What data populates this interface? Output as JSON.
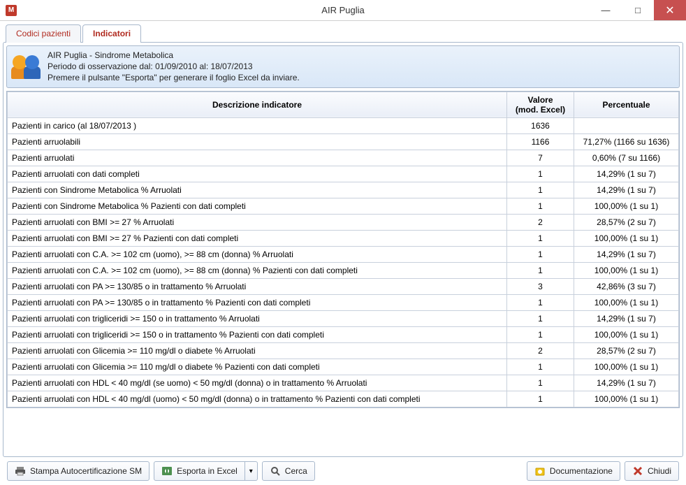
{
  "window": {
    "title": "AIR Puglia",
    "icon_letter": "M"
  },
  "tabs": [
    {
      "label": "Codici pazienti",
      "active": false
    },
    {
      "label": "Indicatori",
      "active": true
    }
  ],
  "infobar": {
    "line1": "AIR Puglia - Sindrome Metabolica",
    "line2": "Periodo di osservazione dal: 01/09/2010 al: 18/07/2013",
    "line3": "Premere il pulsante \"Esporta\" per generare il foglio Excel da inviare."
  },
  "grid": {
    "headers": {
      "desc": "Descrizione indicatore",
      "val_line1": "Valore",
      "val_line2": "(mod. Excel)",
      "pct": "Percentuale"
    },
    "rows": [
      {
        "desc": "Pazienti in carico (al 18/07/2013 )",
        "val": "1636",
        "pct": ""
      },
      {
        "desc": "Pazienti arruolabili",
        "val": "1166",
        "pct": "71,27% (1166 su 1636)"
      },
      {
        "desc": "Pazienti arruolati",
        "val": "7",
        "pct": "0,60% (7 su 1166)"
      },
      {
        "desc": "Pazienti arruolati con dati completi",
        "val": "1",
        "pct": "14,29% (1 su 7)"
      },
      {
        "desc": "Pazienti con Sindrome Metabolica  % Arruolati",
        "val": "1",
        "pct": "14,29% (1 su 7)"
      },
      {
        "desc": "Pazienti con Sindrome Metabolica  % Pazienti con dati completi",
        "val": "1",
        "pct": "100,00% (1 su 1)"
      },
      {
        "desc": "Pazienti arruolati con BMI >= 27  % Arruolati",
        "val": "2",
        "pct": "28,57% (2 su 7)"
      },
      {
        "desc": "Pazienti arruolati con BMI >= 27  % Pazienti con dati completi",
        "val": "1",
        "pct": "100,00% (1 su 1)"
      },
      {
        "desc": "Pazienti arruolati con C.A. >= 102 cm (uomo), >= 88 cm (donna) % Arruolati",
        "val": "1",
        "pct": "14,29% (1 su 7)"
      },
      {
        "desc": "Pazienti arruolati con C.A. >= 102 cm (uomo), >= 88 cm (donna) % Pazienti con dati completi",
        "val": "1",
        "pct": "100,00% (1 su 1)"
      },
      {
        "desc": "Pazienti arruolati con PA >= 130/85 o in trattamento  % Arruolati",
        "val": "3",
        "pct": "42,86% (3 su 7)"
      },
      {
        "desc": "Pazienti arruolati con PA >= 130/85 o in trattamento  % Pazienti con dati completi",
        "val": "1",
        "pct": "100,00% (1 su 1)"
      },
      {
        "desc": "Pazienti arruolati con trigliceridi >= 150 o in trattamento  % Arruolati",
        "val": "1",
        "pct": "14,29% (1 su 7)"
      },
      {
        "desc": "Pazienti arruolati con trigliceridi >= 150 o in trattamento  % Pazienti con dati completi",
        "val": "1",
        "pct": "100,00% (1 su 1)"
      },
      {
        "desc": "Pazienti arruolati con Glicemia >= 110 mg/dl o diabete % Arruolati",
        "val": "2",
        "pct": "28,57% (2 su 7)"
      },
      {
        "desc": "Pazienti arruolati con Glicemia >= 110 mg/dl o diabete % Pazienti con dati completi",
        "val": "1",
        "pct": "100,00% (1 su 1)"
      },
      {
        "desc": "Pazienti arruolati con HDL < 40 mg/dl (se uomo) < 50 mg/dl (donna) o in trattamento  % Arruolati",
        "val": "1",
        "pct": "14,29% (1 su 7)"
      },
      {
        "desc": "Pazienti arruolati con HDL < 40 mg/dl (uomo) < 50 mg/dl (donna) o in trattamento  % Pazienti con dati completi",
        "val": "1",
        "pct": "100,00% (1 su 1)"
      }
    ]
  },
  "buttons": {
    "print": "Stampa Autocertificazione SM",
    "export": "Esporta in Excel",
    "search": "Cerca",
    "docs": "Documentazione",
    "close": "Chiudi"
  }
}
